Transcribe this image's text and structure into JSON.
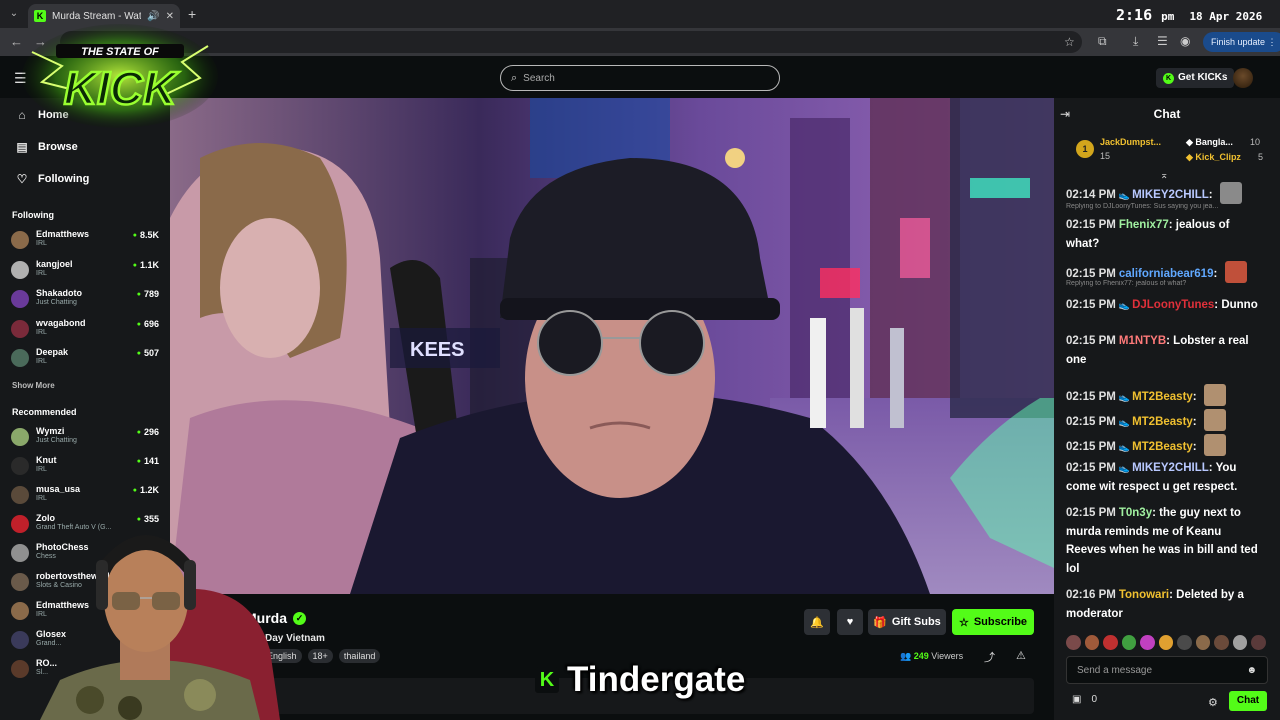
{
  "browser": {
    "tab_title": "Murda Stream - Watch Live",
    "clock_time": "2:16",
    "clock_ampm": "pm",
    "clock_date": "18 Apr 2026",
    "finish_update": "Finish update"
  },
  "header": {
    "search_placeholder": "Search",
    "get_kicks": "Get KICKs",
    "overlay_logo_line1": "THE STATE OF",
    "overlay_logo_line2": "KICK"
  },
  "sidebar": {
    "home": "Home",
    "browse": "Browse",
    "following": "Following",
    "following_head": "Following",
    "following_items": [
      {
        "name": "Edmatthews",
        "category": "IRL",
        "viewers": "8.5K",
        "color": "#8a6a4a"
      },
      {
        "name": "kangjoel",
        "category": "IRL",
        "viewers": "1.1K",
        "color": "#b0b0b0"
      },
      {
        "name": "Shakadoto",
        "category": "Just Chatting",
        "viewers": "789",
        "color": "#6a3a9a"
      },
      {
        "name": "wvagabond",
        "category": "IRL",
        "viewers": "696",
        "color": "#7a2a3a"
      },
      {
        "name": "Deepak",
        "category": "IRL",
        "viewers": "507",
        "color": "#4a6a5a"
      }
    ],
    "show_more": "Show More",
    "recommended_head": "Recommended",
    "recommended_items": [
      {
        "name": "Wymzi",
        "category": "Just Chatting",
        "viewers": "296",
        "color": "#8aa86a"
      },
      {
        "name": "Knut",
        "category": "IRL",
        "viewers": "141",
        "color": "#2a2a2a"
      },
      {
        "name": "musa_usa",
        "category": "IRL",
        "viewers": "1.2K",
        "color": "#5a4a3a"
      },
      {
        "name": "Zolo",
        "category": "Grand Theft Auto V (G...",
        "viewers": "355",
        "color": "#c0202a"
      },
      {
        "name": "PhotoChess",
        "category": "Chess",
        "viewers": "",
        "color": "#909090"
      },
      {
        "name": "robertovstheworld",
        "category": "Slots & Casino",
        "viewers": "",
        "color": "#6a5a4a"
      },
      {
        "name": "Edmatthews",
        "category": "IRL",
        "viewers": "",
        "color": "#8a6a4a"
      },
      {
        "name": "Glosex",
        "category": "Grand...",
        "viewers": "",
        "color": "#3a3a5a"
      },
      {
        "name": "RO...",
        "category": "Sl...",
        "viewers": "",
        "color": "#5a3a2a"
      }
    ]
  },
  "stream": {
    "streamer": "Murda",
    "title": "Day Vietnam",
    "tags": [
      "English",
      "18+",
      "thailand"
    ],
    "gift_subs": "Gift Subs",
    "subscribe": "Subscribe",
    "viewers_count": "249",
    "viewers_label": "Viewers"
  },
  "caption": {
    "text": "Tindergate"
  },
  "chat": {
    "title": "Chat",
    "gifters": [
      {
        "rank": "1",
        "name": "JackDumpst...",
        "count": "15"
      },
      {
        "name": "Bangla...",
        "count": "10"
      },
      {
        "name": "Kick_Clipz",
        "count": "5"
      }
    ],
    "messages": [
      {
        "time": "02:14 PM",
        "badge": "👟",
        "user": "MIKEY2CHILL",
        "color": "#b8c8ff",
        "text": "",
        "emote": "#8a8a8a"
      },
      {
        "reply": "Replying to DJLoonyTunes: Sus saying you jea..."
      },
      {
        "time": "02:15 PM",
        "badge": "",
        "user": "Fhenix77",
        "color": "#a0f0a0",
        "text": "jealous of what?"
      },
      {
        "time": "02:15 PM",
        "badge": "",
        "user": "californiabear619",
        "color": "#60a8ff",
        "text": "",
        "emote": "#c0503a"
      },
      {
        "reply": "Replying to Fhenix77: jealous of what?"
      },
      {
        "time": "02:15 PM",
        "badge": "👟",
        "user": "DJLoonyTunes",
        "color": "#e0303a",
        "text": "Dunno"
      },
      {
        "time": "02:15 PM",
        "badge": "",
        "user": "M1NTYB",
        "color": "#ff7a7a",
        "text": "Lobster a real one"
      },
      {
        "time": "02:15 PM",
        "badge": "👟",
        "user": "MT2Beasty",
        "color": "#f0c030",
        "text": "",
        "emote": "#b09070"
      },
      {
        "time": "02:15 PM",
        "badge": "👟",
        "user": "MT2Beasty",
        "color": "#f0c030",
        "text": "",
        "emote": "#b09070"
      },
      {
        "time": "02:15 PM",
        "badge": "👟",
        "user": "MT2Beasty",
        "color": "#f0c030",
        "text": "",
        "emote": "#b09070"
      },
      {
        "time": "02:15 PM",
        "badge": "👟",
        "user": "MIKEY2CHILL",
        "color": "#b8c8ff",
        "text": "You come wit respect u get respect."
      },
      {
        "time": "02:15 PM",
        "badge": "",
        "user": "T0n3y",
        "color": "#a0f0a0",
        "text": "the guy next to murda reminds me of Keanu Reeves when he was in bill and ted lol"
      },
      {
        "time": "02:16 PM",
        "badge": "",
        "user": "Tonowari",
        "color": "#f0c030",
        "text": "Deleted by a moderator"
      }
    ],
    "send_placeholder": "Send a message",
    "kicks_count": "0",
    "chat_button": "Chat"
  }
}
